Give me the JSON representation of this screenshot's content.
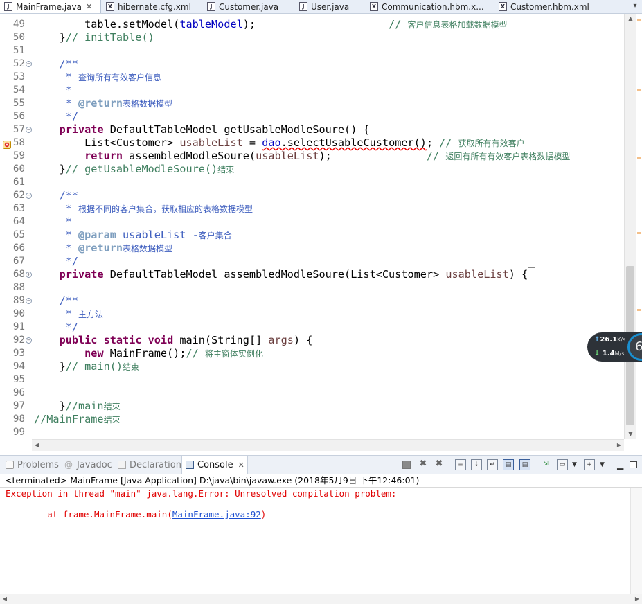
{
  "editor_tabs": [
    {
      "label": "MainFrame.java",
      "icon": "java-file-icon",
      "glyph": "J",
      "active": true,
      "close": "✕"
    },
    {
      "label": "hibernate.cfg.xml",
      "icon": "xml-file-icon",
      "glyph": "X"
    },
    {
      "label": "Customer.java",
      "icon": "java-file-icon",
      "glyph": "J"
    },
    {
      "label": "User.java",
      "icon": "java-file-icon",
      "glyph": "J"
    },
    {
      "label": "Communication.hbm.x...",
      "icon": "xml-file-icon",
      "glyph": "X"
    },
    {
      "label": "Customer.hbm.xml",
      "icon": "xml-file-icon",
      "glyph": "X"
    }
  ],
  "editor": {
    "lines": [
      {
        "num": "49",
        "html": "        table.setModel(<span class=\"fld\">tableModel</span>);                     <span class=\"cm\">// <span class=\"cjk\">客户信息表格加载数据模型</span></span>"
      },
      {
        "num": "50",
        "html": "    }<span class=\"cm\">// initTable()</span>"
      },
      {
        "num": "51",
        "html": ""
      },
      {
        "num": "52",
        "fold": "collapse",
        "html": "    <span class=\"jd\">/**</span>"
      },
      {
        "num": "53",
        "html": "     <span class=\"jd\">* <span class=\"cjk\">查询所有有效客户信息</span></span>"
      },
      {
        "num": "54",
        "html": "     <span class=\"jd\">*</span>"
      },
      {
        "num": "55",
        "html": "     <span class=\"jd\">* </span><span class=\"tag\">@return</span><span class=\"jd cjk\">表格数据模型</span>"
      },
      {
        "num": "56",
        "html": "     <span class=\"jd\">*/</span>"
      },
      {
        "num": "57",
        "fold": "collapse",
        "html": "    <span class=\"kw\">private</span> DefaultTableModel getUsableModleSoure() {"
      },
      {
        "num": "58",
        "error": true,
        "html": "        List&lt;Customer&gt; <span class=\"var\">usableList</span> = <span class=\"squiggle\"><span class=\"fld\">dao</span>.selectUsableCustomer()</span>; <span class=\"cm\">// <span class=\"cjk\">获取所有有效客户</span></span>"
      },
      {
        "num": "59",
        "html": "        <span class=\"kw\">return</span> assembledModleSoure(<span class=\"var\">usableList</span>);               <span class=\"cm\">// <span class=\"cjk\">返回有所有有效客户表格数据模型</span></span>"
      },
      {
        "num": "60",
        "html": "    }<span class=\"cm\">// getUsableModleSoure()<span class=\"cjk\">结束</span></span>"
      },
      {
        "num": "61",
        "html": ""
      },
      {
        "num": "62",
        "fold": "collapse",
        "html": "    <span class=\"jd\">/**</span>"
      },
      {
        "num": "63",
        "html": "     <span class=\"jd\">* <span class=\"cjk\">根据不同的客户集合，获取相应的表格数据模型</span></span>"
      },
      {
        "num": "64",
        "html": "     <span class=\"jd\">*</span>"
      },
      {
        "num": "65",
        "html": "     <span class=\"jd\">* </span><span class=\"tag\">@param</span><span class=\"jd\"> usableList -<span class=\"cjk\">客户集合</span></span>"
      },
      {
        "num": "66",
        "html": "     <span class=\"jd\">* </span><span class=\"tag\">@return</span><span class=\"jd cjk\">表格数据模型</span>"
      },
      {
        "num": "67",
        "html": "     <span class=\"jd\">*/</span>"
      },
      {
        "num": "68",
        "fold": "expand",
        "html": "    <span class=\"kw\">private</span> DefaultTableModel assembledModleSoure(List&lt;Customer&gt; <span class=\"var\">usableList</span>) {<span style=\"border:1px solid #888;\">&nbsp;</span>"
      },
      {
        "num": "88",
        "html": ""
      },
      {
        "num": "89",
        "fold": "collapse",
        "html": "    <span class=\"jd\">/**</span>"
      },
      {
        "num": "90",
        "html": "     <span class=\"jd\">* <span class=\"cjk\">主方法</span></span>"
      },
      {
        "num": "91",
        "html": "     <span class=\"jd\">*/</span>"
      },
      {
        "num": "92",
        "fold": "collapse",
        "html": "    <span class=\"kw\">public</span> <span class=\"kw\">static</span> <span class=\"kw\">void</span> main(String[] <span class=\"var\">args</span>) {"
      },
      {
        "num": "93",
        "html": "        <span class=\"kw\">new</span> MainFrame();<span class=\"cm\">// <span class=\"cjk\">将主窗体实例化</span></span>"
      },
      {
        "num": "94",
        "html": "    }<span class=\"cm\">// main()<span class=\"cjk\">结束</span></span>"
      },
      {
        "num": "95",
        "html": ""
      },
      {
        "num": "96",
        "html": ""
      },
      {
        "num": "97",
        "html": "    }<span class=\"cm\">//main<span class=\"cjk\">结束</span></span>"
      },
      {
        "num": "98",
        "html": "<span class=\"cm\">//MainFrame<span class=\"cjk\">结束</span></span>"
      },
      {
        "num": "99",
        "html": ""
      }
    ]
  },
  "net_speed": {
    "up_value": "26.1",
    "up_unit": "K/s",
    "down_value": "1.4",
    "down_unit": "M/s",
    "badge": "6"
  },
  "view_tabs": [
    {
      "label": "Problems",
      "name": "problems"
    },
    {
      "label": "Javadoc",
      "name": "javadoc"
    },
    {
      "label": "Declaration",
      "name": "declaration"
    },
    {
      "label": "Console",
      "name": "console",
      "active": true,
      "close": "✕"
    }
  ],
  "console": {
    "description": "<terminated> MainFrame [Java Application] D:\\java\\bin\\javaw.exe (2018年5月9日 下午12:46:01)",
    "error_line": "Exception in thread \"main\" java.lang.Error: Unresolved compilation problem: ",
    "stack_prefix": "\tat frame.MainFrame.main(",
    "stack_link": "MainFrame.java:92",
    "stack_suffix": ")"
  },
  "colors": {
    "keyword": "#7f0055",
    "comment": "#3f7f5f",
    "javadoc": "#3f5fbf",
    "field": "#0000c0",
    "error_text": "#e00000",
    "link": "#1d4fd0"
  }
}
